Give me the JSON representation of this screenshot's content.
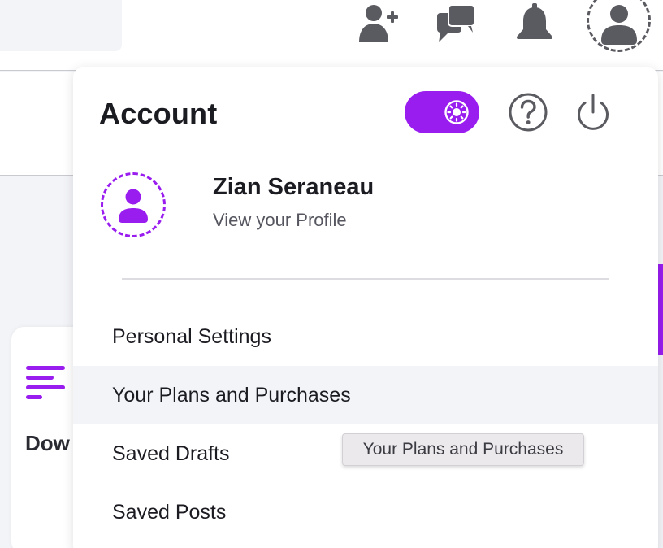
{
  "header": {
    "icons": [
      "add-user-icon",
      "chat-icon",
      "bell-icon",
      "user-avatar-icon"
    ]
  },
  "side_card": {
    "label": "Dow"
  },
  "account": {
    "title": "Account",
    "profile": {
      "name": "Zian Seraneau",
      "subtitle": "View your Profile"
    },
    "menu": [
      {
        "label": "Personal Settings"
      },
      {
        "label": "Your Plans and Purchases"
      },
      {
        "label": "Saved Drafts"
      },
      {
        "label": "Saved Posts"
      }
    ],
    "hovered_item": "Your Plans and Purchases",
    "theme_toggle": {
      "icon": "sun-icon",
      "on": true
    },
    "actions": [
      "help-icon",
      "power-icon"
    ]
  },
  "tooltip": {
    "text": "Your Plans and Purchases"
  },
  "colors": {
    "accent": "#9a1df0",
    "icon_gray": "#5a5a61",
    "hover_bg": "#f3f4f8"
  }
}
